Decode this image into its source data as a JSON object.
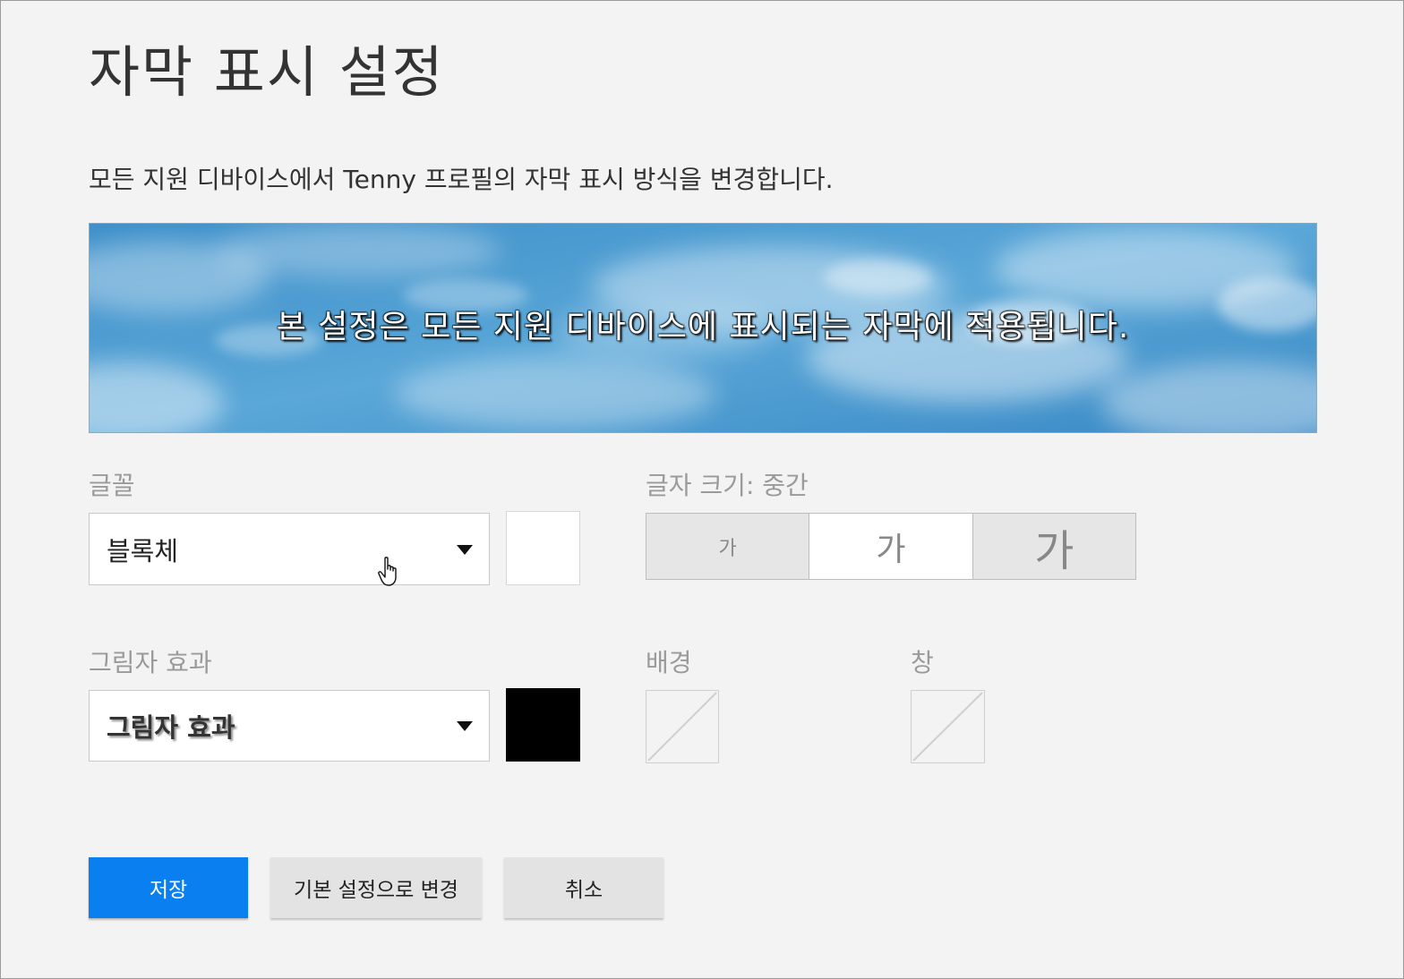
{
  "page": {
    "title": "자막 표시 설정",
    "description": "모든 지원 디바이스에서 Tenny 프로필의 자막 표시 방식을 변경합니다."
  },
  "preview": {
    "caption": "본 설정은 모든 지원 디바이스에 표시되는 자막에 적용됩니다."
  },
  "font": {
    "label": "글꼴",
    "selected": "블록체",
    "color": "#ffffff"
  },
  "text_size": {
    "label": "글자 크기: 중간",
    "options": [
      {
        "label": "가",
        "size": "small",
        "selected": false
      },
      {
        "label": "가",
        "size": "medium",
        "selected": true
      },
      {
        "label": "가",
        "size": "large",
        "selected": false
      }
    ]
  },
  "shadow": {
    "label": "그림자 효과",
    "selected": "그림자 효과",
    "color": "#000000"
  },
  "background": {
    "label": "배경",
    "color": "none"
  },
  "window": {
    "label": "창",
    "color": "none"
  },
  "buttons": {
    "save": "저장",
    "reset": "기본 설정으로 변경",
    "cancel": "취소"
  },
  "colors": {
    "primary": "#0a80f0",
    "page_background": "#f3f3f3"
  }
}
